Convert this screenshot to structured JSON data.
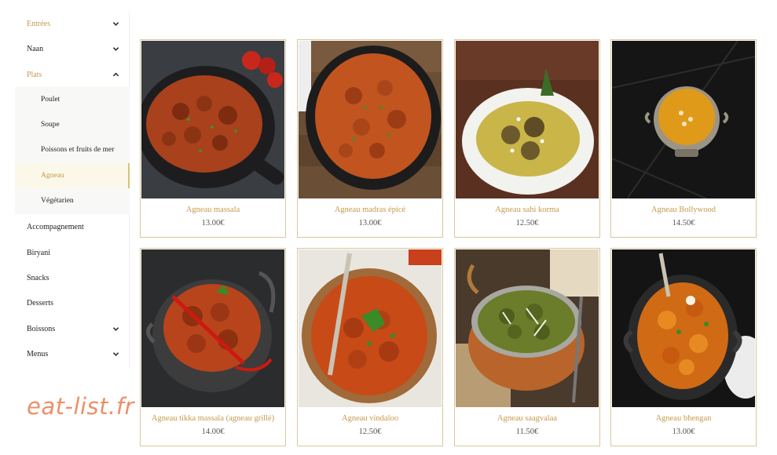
{
  "sidebar": {
    "items": [
      {
        "label": "Entrées",
        "icon": "chevron-down-icon"
      },
      {
        "label": "Naan",
        "icon": "chevron-down-icon"
      },
      {
        "label": "Plats",
        "icon": "chevron-up-icon"
      },
      {
        "label": "Accompagnement"
      },
      {
        "label": "Biryani"
      },
      {
        "label": "Snacks"
      },
      {
        "label": "Desserts"
      },
      {
        "label": "Boissons",
        "icon": "chevron-down-icon"
      },
      {
        "label": "Menus",
        "icon": "chevron-down-icon"
      }
    ],
    "plats_sub": [
      {
        "label": "Poulet"
      },
      {
        "label": "Soupe"
      },
      {
        "label": "Poissons et fruits de mer"
      },
      {
        "label": "Agneau",
        "active": true
      },
      {
        "label": "Végétarien"
      }
    ]
  },
  "products": [
    {
      "name": "Agneau massala",
      "price": "13.00€"
    },
    {
      "name": "Agneau madras épicé",
      "price": "13.00€"
    },
    {
      "name": "Agneau sahi korma",
      "price": "12.50€"
    },
    {
      "name": "Agneau Bollywood",
      "price": "14.50€"
    },
    {
      "name": "Agneau tikka massala (agneau grillé)",
      "price": "14.00€"
    },
    {
      "name": "Agneau vindaloo",
      "price": "12.50€"
    },
    {
      "name": "Agneau saagvalaa",
      "price": "11.50€"
    },
    {
      "name": "Agneau bhengan",
      "price": "13.00€"
    }
  ],
  "watermark": "eat-list.fr",
  "colors": {
    "accent_gold": "#c49a4a",
    "card_border": "#d8c89c",
    "active_bg": "#fbf8e9",
    "watermark": "#ee8f6a"
  }
}
